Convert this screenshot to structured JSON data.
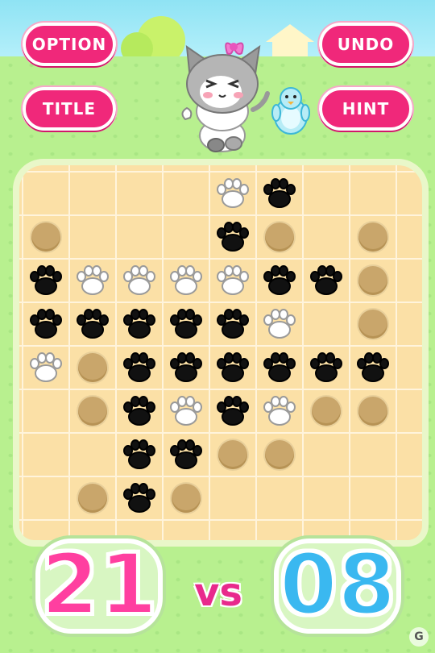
{
  "buttons": {
    "option": "OPTION",
    "title": "TITLE",
    "undo": "UNDO",
    "hint": "HINT"
  },
  "score": {
    "player": "21",
    "vs": "vs",
    "opponent": "08"
  },
  "watermark": "G",
  "colors": {
    "button": "#f0287a",
    "player_score": "#ff3fa0",
    "opponent_score": "#3ab8f0",
    "black_paw": "#111111",
    "white_paw": "#ffffff",
    "hole": "#c9a66b"
  },
  "board": {
    "cols": 8,
    "rows": 8,
    "legend": "B = black paw, W = white paw, H = empty hole (valid move hint), . = empty",
    "cells": [
      [
        ".",
        ".",
        ".",
        ".",
        "W",
        "B",
        ".",
        "."
      ],
      [
        "H",
        ".",
        ".",
        ".",
        "B",
        "H",
        ".",
        "H"
      ],
      [
        "B",
        "W",
        "W",
        "W",
        "W",
        "B",
        "B",
        "H"
      ],
      [
        "B",
        "B",
        "B",
        "B",
        "B",
        "W",
        ".",
        "H"
      ],
      [
        "W",
        "H",
        "B",
        "B",
        "B",
        "B",
        "B",
        "B"
      ],
      [
        ".",
        "H",
        "B",
        "W",
        "B",
        "W",
        "H",
        "H"
      ],
      [
        ".",
        ".",
        "B",
        "B",
        "H",
        "H",
        ".",
        "."
      ],
      [
        ".",
        "H",
        "B",
        "H",
        ".",
        ".",
        ".",
        "."
      ]
    ]
  }
}
